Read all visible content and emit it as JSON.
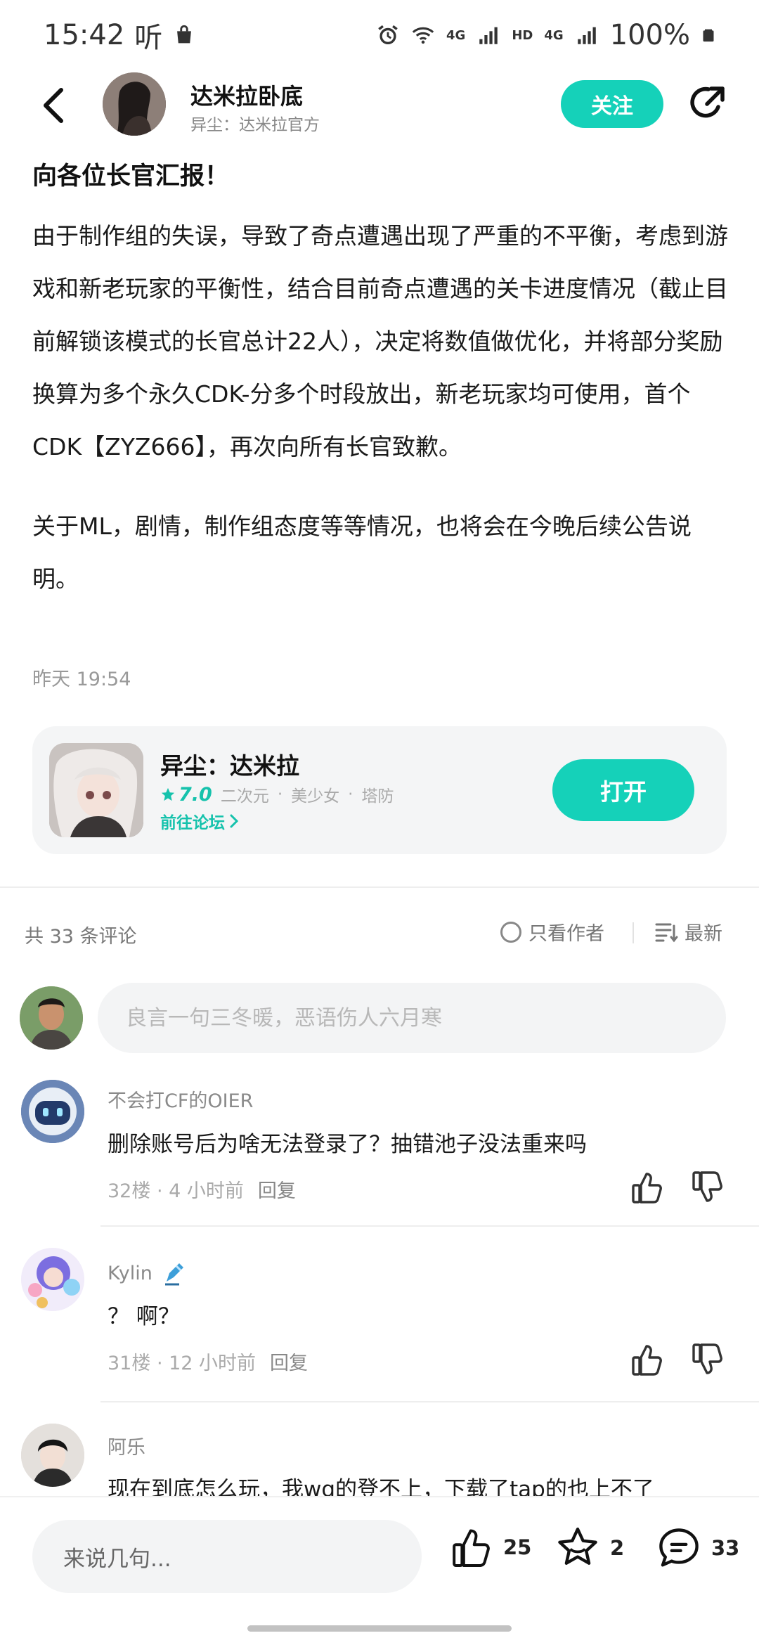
{
  "status_bar": {
    "time": "15:42",
    "extra_glyph": "听",
    "net1": "4G",
    "hd": "HD",
    "net2": "4G",
    "battery": "100%"
  },
  "header": {
    "author_name": "达米拉卧底",
    "author_subtitle": "异尘：达米拉官方",
    "follow_label": "关注"
  },
  "post": {
    "title": "向各位长官汇报！",
    "paragraph1": "由于制作组的失误，导致了奇点遭遇出现了严重的不平衡，考虑到游戏和新老玩家的平衡性，结合目前奇点遭遇的关卡进度情况（截止目前解锁该模式的长官总计22人），决定将数值做优化，并将部分奖励换算为多个永久CDK-分多个时段放出，新老玩家均可使用，首个CDK【ZYZ666】，再次向所有长官致歉。",
    "paragraph2": "关于ML，剧情，制作组态度等等情况，也将会在今晚后续公告说明。",
    "time": "昨天 19:54"
  },
  "game_card": {
    "name": "异尘：达米拉",
    "rating": "7.0",
    "tags": [
      "二次元",
      "美少女",
      "塔防"
    ],
    "tag_sep": "·",
    "forum_link": "前往论坛",
    "open_label": "打开"
  },
  "comments_header": {
    "count_text": "共 33 条评论",
    "author_only": "只看作者",
    "sort_label": "最新"
  },
  "comment_input": {
    "placeholder": "良言一句三冬暖，恶语伤人六月寒"
  },
  "comments": [
    {
      "user": "不会打CF的OIER",
      "text": "删除账号后为啥无法登录了？抽错池子没法重来吗",
      "floor_time": "32楼 · 4 小时前",
      "reply": "回复"
    },
    {
      "user": "Kylin",
      "text": "？ 啊？",
      "floor_time": "31楼 · 12 小时前",
      "reply": "回复"
    },
    {
      "user": "阿乐",
      "text": "现在到底怎么玩，我wg的登不上，下载了tap的也上不了"
    }
  ],
  "bottom_bar": {
    "input_placeholder": "来说几句...",
    "likes": "25",
    "favorites": "2",
    "comments": "33"
  },
  "colors": {
    "accent": "#15d1b9",
    "accent_text": "#15c2ac"
  }
}
